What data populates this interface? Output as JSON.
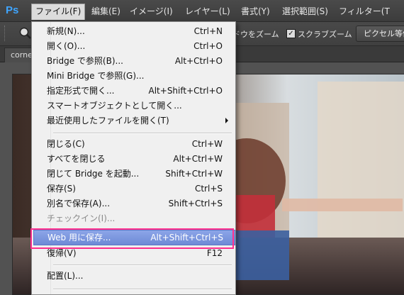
{
  "app": {
    "logo": "Ps"
  },
  "menubar": {
    "items": [
      {
        "label": "ファイル(F)"
      },
      {
        "label": "編集(E)"
      },
      {
        "label": "イメージ(I)"
      },
      {
        "label": "レイヤー(L)"
      },
      {
        "label": "書式(Y)"
      },
      {
        "label": "選択範囲(S)"
      },
      {
        "label": "フィルター(T"
      }
    ]
  },
  "optionsbar": {
    "resize_zoom_label": "ドウをズーム",
    "scrubby_zoom_checked": "✓",
    "scrubby_zoom_label": "スクラブズーム",
    "fit_button_label": "ピクセル等倍"
  },
  "document": {
    "tab_label": "corne"
  },
  "file_menu": {
    "items": [
      {
        "label": "新規(N)...",
        "shortcut": "Ctrl+N"
      },
      {
        "label": "開く(O)...",
        "shortcut": "Ctrl+O"
      },
      {
        "label": "Bridge で参照(B)...",
        "shortcut": "Alt+Ctrl+O"
      },
      {
        "label": "Mini Bridge で参照(G)...",
        "shortcut": ""
      },
      {
        "label": "指定形式で開く...",
        "shortcut": "Alt+Shift+Ctrl+O"
      },
      {
        "label": "スマートオブジェクトとして開く...",
        "shortcut": ""
      },
      {
        "label": "最近使用したファイルを開く(T)",
        "shortcut": ""
      },
      {
        "label": "閉じる(C)",
        "shortcut": "Ctrl+W"
      },
      {
        "label": "すべてを閉じる",
        "shortcut": "Alt+Ctrl+W"
      },
      {
        "label": "閉じて Bridge を起動...",
        "shortcut": "Shift+Ctrl+W"
      },
      {
        "label": "保存(S)",
        "shortcut": "Ctrl+S"
      },
      {
        "label": "別名で保存(A)...",
        "shortcut": "Shift+Ctrl+S"
      },
      {
        "label": "チェックイン(I)...",
        "shortcut": ""
      },
      {
        "label": "Web 用に保存...",
        "shortcut": "Alt+Shift+Ctrl+S"
      },
      {
        "label": "復帰(V)",
        "shortcut": "F12"
      },
      {
        "label": "配置(L)...",
        "shortcut": ""
      }
    ]
  },
  "colors": {
    "highlight": "#6e8ad6",
    "annotation": "#ff2f8e",
    "ps_blue": "#3fa5ff"
  }
}
